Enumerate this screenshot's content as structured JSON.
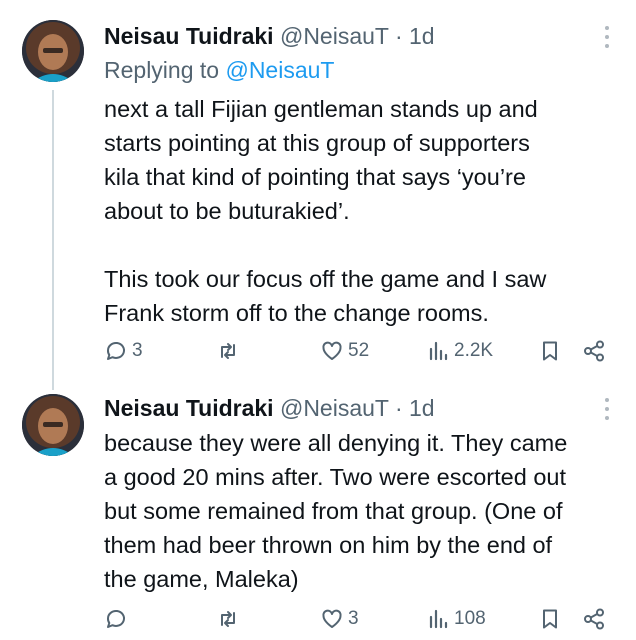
{
  "tweets": [
    {
      "author_name": "Neisau Tuidraki",
      "handle": "@NeisauT",
      "separator": "·",
      "time": "1d",
      "replying_prefix": "Replying to",
      "replying_to": "@NeisauT",
      "text": "next a tall Fijian gentleman stands up and\nstarts pointing at this group of supporters\nkila that kind of pointing that says ‘you’re\nabout to be buturakied’.\n\nThis took our focus off the game and I saw\nFrank storm off to the change rooms.",
      "replies": "3",
      "retweets": "",
      "likes": "52",
      "views": "2.2K"
    },
    {
      "author_name": "Neisau Tuidraki",
      "handle": "@NeisauT",
      "separator": "·",
      "time": "1d",
      "text": "because they were all denying it. They came\na good 20 mins after. Two were escorted out\nbut some remained from that group. (One of\nthem had beer thrown on him by the end of\nthe game, Maleka)",
      "replies": "",
      "retweets": "",
      "likes": "3",
      "views": "108"
    }
  ],
  "colors": {
    "text": "#0f1419",
    "secondary": "#536471",
    "link": "#1d9bf0",
    "thread_line": "#cfd9de"
  },
  "icons": [
    "reply-icon",
    "retweet-icon",
    "like-icon",
    "views-icon",
    "bookmark-icon",
    "share-icon",
    "more-icon"
  ]
}
